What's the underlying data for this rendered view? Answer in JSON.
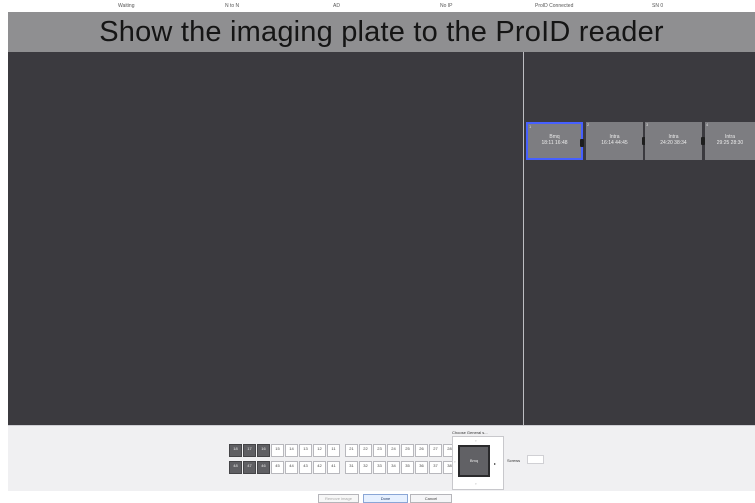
{
  "status_bar": [
    {
      "label": "Waiting"
    },
    {
      "label": "N to N"
    },
    {
      "label": "AD"
    },
    {
      "label": "No IP"
    },
    {
      "label": "ProID Connected"
    },
    {
      "label": "SN 0"
    }
  ],
  "banner": {
    "text": "Show the imaging plate to the ProID reader"
  },
  "thumbnails": [
    {
      "index": "1",
      "line1": "Bmq",
      "line2": "18:11 16:48",
      "selected": true
    },
    {
      "index": "2",
      "line1": "Intra",
      "line2": "16:14 44:45",
      "selected": false
    },
    {
      "index": "3",
      "line1": "Intra",
      "line2": "24:20 38:34",
      "selected": false
    },
    {
      "index": "4",
      "line1": "Intra",
      "line2": "29:25 28:30",
      "selected": false
    }
  ],
  "teeth": {
    "upper": [
      "18",
      "17",
      "16",
      "15",
      "14",
      "13",
      "12",
      "11",
      "21",
      "22",
      "23",
      "24",
      "25",
      "26",
      "27",
      "28"
    ],
    "lower": [
      "48",
      "47",
      "46",
      "45",
      "44",
      "43",
      "42",
      "41",
      "31",
      "32",
      "33",
      "34",
      "35",
      "36",
      "37",
      "38"
    ]
  },
  "plate_selector": {
    "label": "Choose General s...",
    "plate_label": "Bmq"
  },
  "screws": {
    "label": "Screws",
    "value": ""
  },
  "buttons": {
    "remove_image": "Remove image",
    "done": "Done",
    "cancel": "Cancel"
  },
  "colors": {
    "banner_bg": "#8f8f91",
    "main_bg": "#3b3a3f",
    "selected_border": "#4660ff"
  }
}
